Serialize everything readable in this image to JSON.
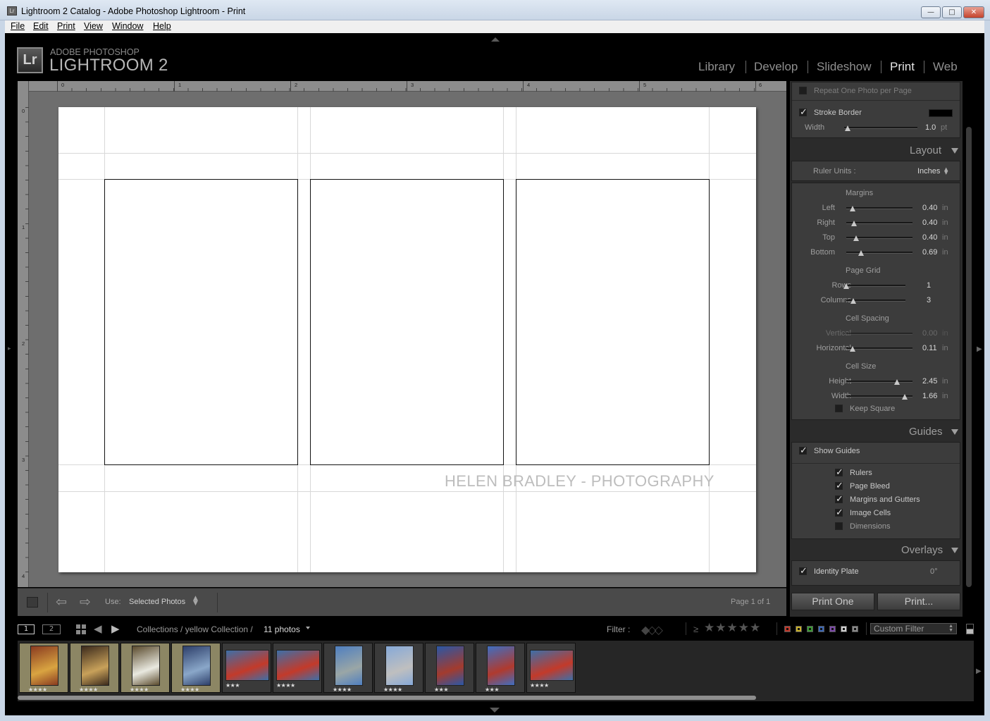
{
  "window": {
    "title": "Lightroom 2 Catalog - Adobe Photoshop Lightroom - Print",
    "controls": [
      "minimize",
      "maximize",
      "close"
    ]
  },
  "menu": [
    "File",
    "Edit",
    "Print",
    "View",
    "Window",
    "Help"
  ],
  "brand": {
    "badge": "Lr",
    "line1": "ADOBE PHOTOSHOP",
    "line2": "LIGHTROOM 2"
  },
  "modules": [
    {
      "label": "Library",
      "active": false
    },
    {
      "label": "Develop",
      "active": false
    },
    {
      "label": "Slideshow",
      "active": false
    },
    {
      "label": "Print",
      "active": true
    },
    {
      "label": "Web",
      "active": false
    }
  ],
  "rulers": {
    "top": [
      "0",
      "1",
      "2",
      "3",
      "4",
      "5",
      "6"
    ],
    "left": [
      "0",
      "1",
      "2",
      "3",
      "4"
    ]
  },
  "page": {
    "identity_plate_text": "HELEN BRADLEY - PHOTOGRAPHY",
    "cells": 3
  },
  "toolbar": {
    "use_label": "Use:",
    "use_value": "Selected Photos",
    "page_indicator": "Page 1 of 1"
  },
  "panel": {
    "image_settings": {
      "repeat_one_photo": {
        "label": "Repeat One Photo per Page",
        "checked": false
      },
      "stroke_border": {
        "label": "Stroke Border",
        "checked": true,
        "color": "#000000"
      },
      "width": {
        "label": "Width",
        "value": "1.0",
        "unit": "pt",
        "fraction": 0.05
      }
    },
    "layout": {
      "title": "Layout",
      "ruler_units_label": "Ruler Units :",
      "ruler_units_value": "Inches",
      "margins_heading": "Margins",
      "margins": [
        {
          "label": "Left",
          "value": "0.40",
          "unit": "in",
          "fraction": 0.1
        },
        {
          "label": "Right",
          "value": "0.40",
          "unit": "in",
          "fraction": 0.12
        },
        {
          "label": "Top",
          "value": "0.40",
          "unit": "in",
          "fraction": 0.15
        },
        {
          "label": "Bottom",
          "value": "0.69",
          "unit": "in",
          "fraction": 0.22
        }
      ],
      "page_grid_heading": "Page Grid",
      "grid": [
        {
          "label": "Rows",
          "value": "1",
          "fraction": 0.0
        },
        {
          "label": "Columns",
          "value": "3",
          "fraction": 0.12
        }
      ],
      "cell_spacing_heading": "Cell Spacing",
      "spacing": [
        {
          "label": "Vertical",
          "value": "0.00",
          "unit": "in",
          "fraction": 0.0,
          "disabled": true
        },
        {
          "label": "Horizontal",
          "value": "0.11",
          "unit": "in",
          "fraction": 0.1
        }
      ],
      "cell_size_heading": "Cell Size",
      "cell_size": [
        {
          "label": "Height",
          "value": "2.45",
          "unit": "in",
          "fraction": 0.77
        },
        {
          "label": "Width",
          "value": "1.66",
          "unit": "in",
          "fraction": 0.88
        }
      ],
      "keep_square": {
        "label": "Keep Square",
        "checked": false
      }
    },
    "guides": {
      "title": "Guides",
      "show_guides": {
        "label": "Show Guides",
        "checked": true
      },
      "items": [
        {
          "label": "Rulers",
          "checked": true
        },
        {
          "label": "Page Bleed",
          "checked": true
        },
        {
          "label": "Margins and Gutters",
          "checked": true
        },
        {
          "label": "Image Cells",
          "checked": true
        },
        {
          "label": "Dimensions",
          "checked": false
        }
      ]
    },
    "overlays": {
      "title": "Overlays",
      "identity_plate": {
        "label": "Identity Plate",
        "checked": true,
        "angle": "0°"
      }
    },
    "buttons": {
      "print_one": "Print One",
      "print": "Print..."
    }
  },
  "filmstrip_bar": {
    "view1": "1",
    "view2": "2",
    "path": "Collections / yellow Collection /",
    "count": "11 photos",
    "filter_label": "Filter :",
    "rating_op": "≥",
    "stars": "★★★★★",
    "filter_preset": "Custom Filter"
  },
  "filmstrip": [
    {
      "stars": "★★★★",
      "selected": true,
      "subject": "carousel horse",
      "colors": [
        "#8a3b20",
        "#d9a441"
      ]
    },
    {
      "stars": "★★★★",
      "selected": true,
      "subject": "carousel rabbit",
      "colors": [
        "#3b2a1c",
        "#c8a15a"
      ]
    },
    {
      "stars": "★★★★",
      "selected": true,
      "subject": "carousel panda",
      "colors": [
        "#5a4a2c",
        "#e9e9e0"
      ]
    },
    {
      "stars": "★★★★",
      "selected": true,
      "subject": "carousel bear",
      "colors": [
        "#2d3f6a",
        "#8aa7c9"
      ]
    },
    {
      "stars": "★★★",
      "selected": false,
      "subject": "street sign",
      "colors": [
        "#3d6fa8",
        "#c33a2a"
      ]
    },
    {
      "stars": "★★★★",
      "selected": false,
      "subject": "street sign",
      "colors": [
        "#3d6fa8",
        "#c33a2a"
      ]
    },
    {
      "stars": "★★★★",
      "selected": false,
      "subject": "clock tower",
      "colors": [
        "#4f7fc0",
        "#9aa6a6"
      ]
    },
    {
      "stars": "★★★★",
      "selected": false,
      "subject": "clock tower",
      "colors": [
        "#86a9d8",
        "#bfbfbf"
      ]
    },
    {
      "stars": "★★★",
      "selected": false,
      "subject": "street building",
      "colors": [
        "#2a57a6",
        "#a33b2e"
      ]
    },
    {
      "stars": "★★★",
      "selected": false,
      "subject": "street building",
      "colors": [
        "#3f6ec1",
        "#b03a2e"
      ]
    },
    {
      "stars": "★★★★",
      "selected": false,
      "subject": "street sign",
      "colors": [
        "#3d6fa8",
        "#c33a2a"
      ]
    }
  ],
  "label_colors": [
    "#c0392b",
    "#c9b12b",
    "#3d9b35",
    "#3b67b5",
    "#7c4aa8",
    "#d0d0d0",
    "#8a8a8a"
  ]
}
